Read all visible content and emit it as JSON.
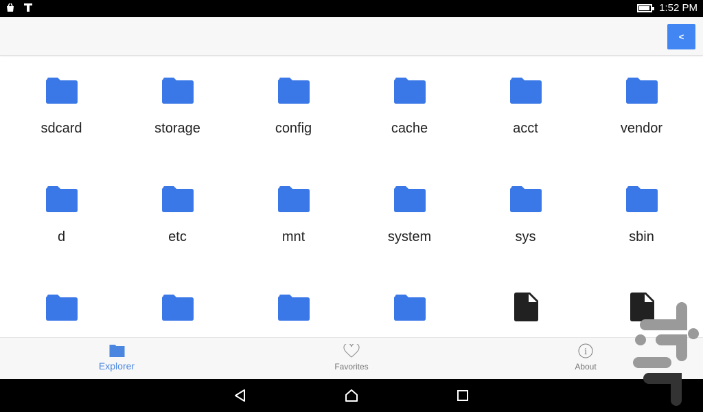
{
  "status_bar": {
    "time": "1:52 PM",
    "battery_level": 0.8,
    "notification_icons": [
      "bag-icon",
      "text-t-icon"
    ]
  },
  "toolbar": {
    "back_label": "<"
  },
  "colors": {
    "accent": "#4286f4",
    "folder": "#3b78e7",
    "file": "#212121"
  },
  "files": [
    {
      "name": "sdcard",
      "type": "folder"
    },
    {
      "name": "storage",
      "type": "folder"
    },
    {
      "name": "config",
      "type": "folder"
    },
    {
      "name": "cache",
      "type": "folder"
    },
    {
      "name": "acct",
      "type": "folder"
    },
    {
      "name": "vendor",
      "type": "folder"
    },
    {
      "name": "d",
      "type": "folder"
    },
    {
      "name": "etc",
      "type": "folder"
    },
    {
      "name": "mnt",
      "type": "folder"
    },
    {
      "name": "system",
      "type": "folder"
    },
    {
      "name": "sys",
      "type": "folder"
    },
    {
      "name": "sbin",
      "type": "folder"
    },
    {
      "name": "",
      "type": "folder"
    },
    {
      "name": "",
      "type": "folder"
    },
    {
      "name": "",
      "type": "folder"
    },
    {
      "name": "",
      "type": "folder"
    },
    {
      "name": "",
      "type": "file"
    },
    {
      "name": "",
      "type": "file"
    }
  ],
  "bottom_nav": {
    "items": [
      {
        "label": "Explorer",
        "icon": "folder-icon",
        "active": true
      },
      {
        "label": "Favorites",
        "icon": "heart-icon",
        "active": false
      },
      {
        "label": "About",
        "icon": "info-icon",
        "active": false
      }
    ]
  },
  "system_nav": {
    "buttons": [
      "back",
      "home",
      "recents"
    ]
  }
}
